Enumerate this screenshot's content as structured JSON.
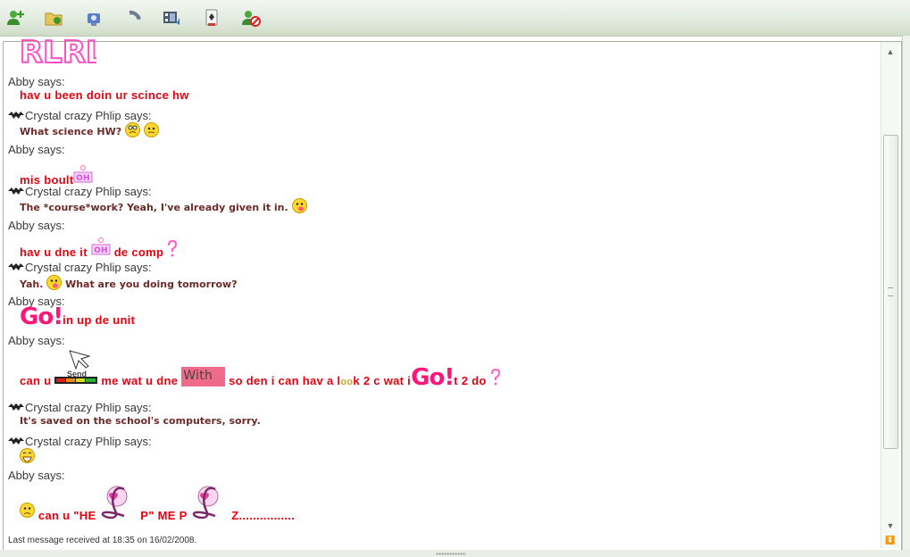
{
  "toolbar": {
    "buttons": [
      {
        "icon": "add-contact-icon"
      },
      {
        "icon": "send-files-icon"
      },
      {
        "icon": "webcam-icon"
      },
      {
        "icon": "call-icon"
      },
      {
        "icon": "video-icon"
      },
      {
        "icon": "games-icon"
      },
      {
        "icon": "block-contact-icon"
      }
    ]
  },
  "conversation": {
    "header_image_text": "RLRL",
    "messages": [
      {
        "sender": "Abby says:",
        "text": "hav u been doin ur scince hw"
      },
      {
        "sender": "Crystal crazy Phlip says:",
        "text": "What science HW?"
      },
      {
        "sender": "Abby says:",
        "text": "mis boult",
        "image_text": "OH"
      },
      {
        "sender": "Crystal crazy Phlip says:",
        "text": "The *course*work? Yeah, I've already given it in."
      },
      {
        "sender": "Abby says:",
        "parts": [
          "hav u dne it",
          "de comp"
        ],
        "image_text": "OH"
      },
      {
        "sender": "Crystal crazy Phlip says:",
        "parts": [
          "Yah.",
          "What are you doing tomorrow?"
        ]
      },
      {
        "sender": "Abby says:",
        "go": "Go!",
        "text": "in up de unit"
      },
      {
        "sender": "Abby says:",
        "parts": [
          "can u",
          "me wat u dne",
          "so den i can hav a l",
          "k 2 c wat i",
          "t 2 do"
        ],
        "send_label": "Send",
        "with_label": "With",
        "oo": "oo",
        "go": "Go!"
      },
      {
        "sender": "Crystal crazy Phlip says:",
        "text": "It's saved on the school's computers, sorry."
      },
      {
        "sender": "Crystal crazy Phlip says:"
      },
      {
        "sender": "Abby says:",
        "parts": [
          "can u \"HE",
          "P\" ME P",
          "Z................"
        ]
      }
    ]
  },
  "status": "Last message received at 18:35 on 16/02/2008.",
  "colors": {
    "abby_text": "#e8000f",
    "phlip_text": "#6d2a2a",
    "go_pink": "#ff1678"
  }
}
